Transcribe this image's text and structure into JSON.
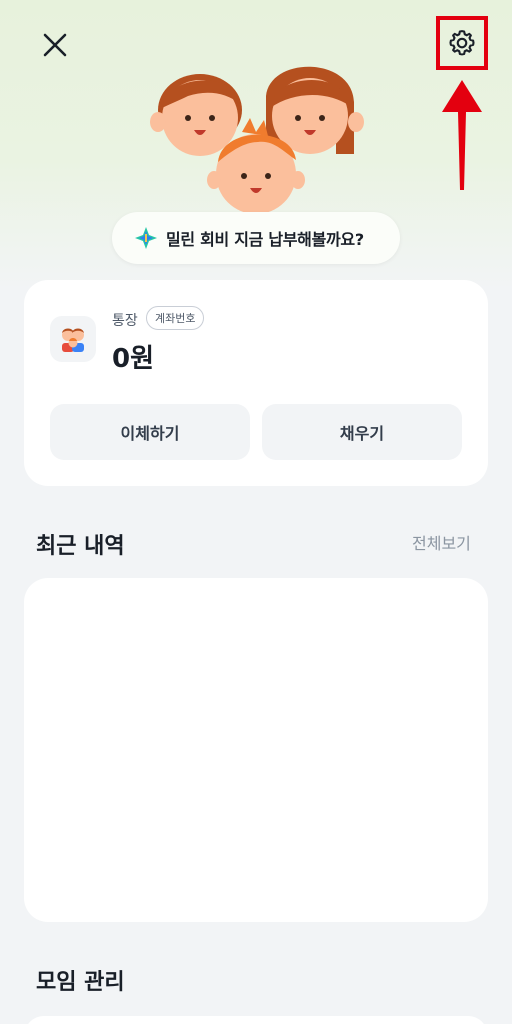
{
  "header": {
    "close_icon": "close-icon",
    "settings_icon": "gear-icon",
    "highlight_color": "#e3000f"
  },
  "banner": {
    "icon": "sparkle-icon",
    "text": "밀린 회비 지금 납부해볼까요?"
  },
  "account": {
    "label": "통장",
    "badge": "계좌번호",
    "balance": "0원",
    "transfer_button": "이체하기",
    "fill_button": "채우기"
  },
  "recent": {
    "title": "최근 내역",
    "see_all": "전체보기"
  },
  "group": {
    "title": "모임 관리"
  },
  "colors": {
    "accent_red": "#e3000f",
    "hair": "#b5501f",
    "face": "#fbbf9c"
  }
}
